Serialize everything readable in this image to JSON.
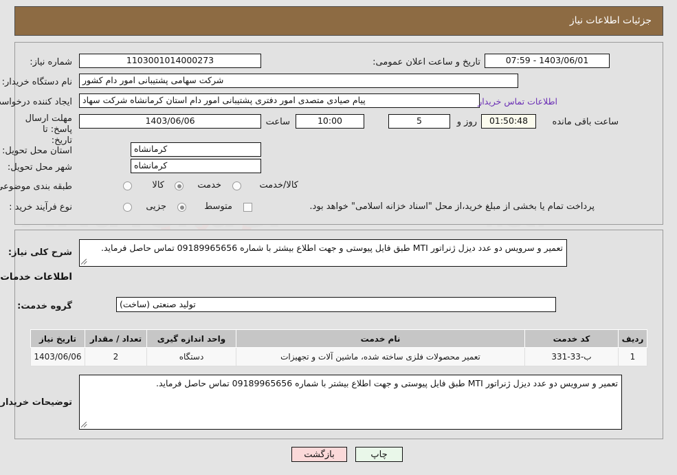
{
  "header": {
    "title": "جزئیات اطلاعات نیاز"
  },
  "form": {
    "need_number_label": "شماره نیاز:",
    "need_number_value": "1103001014000273",
    "public_announcement_label": "تاریخ و ساعت اعلان عمومی:",
    "public_announcement_value": "1403/06/01 - 07:59",
    "buyer_org_label": "نام دستگاه خریدار:",
    "buyer_org_value": "شرکت سهامی پشتیبانی امور دام کشور",
    "requester_label": "ایجاد کننده درخواست:",
    "requester_value": "پیام صیادی متصدی امور دفتری پشتیبانی امور دام استان کرمانشاه شرکت سهاد",
    "buyer_contact_link": "اطلاعات تماس خریدار",
    "deadline_label": "مهلت ارسال پاسخ: تا تاریخ:",
    "deadline_date": "1403/06/06",
    "time_label": "ساعت",
    "deadline_time": "10:00",
    "days_value": "5",
    "days_label": "روز و",
    "countdown_value": "01:50:48",
    "countdown_label": "ساعت باقی مانده",
    "province_label": "استان محل تحویل:",
    "province_value": "کرمانشاه",
    "city_label": "شهر محل تحویل:",
    "city_value": "کرمانشاه",
    "category_label": "طبقه بندی موضوعی:",
    "category_options": [
      "کالا",
      "خدمت",
      "کالا/خدمت"
    ],
    "category_selected": "خدمت",
    "purchase_type_label": "نوع فرآیند خرید :",
    "purchase_type_options": [
      "جزیی",
      "متوسط"
    ],
    "purchase_type_selected": "متوسط",
    "treasury_note": "پرداخت تمام یا بخشی از مبلغ خرید،از محل \"اسناد خزانه اسلامی\" خواهد بود.",
    "treasury_checked": false
  },
  "description": {
    "label": "شرح کلی نیاز:",
    "value": "تعمیر و سرویس دو عدد دیزل ژنراتور MTI طبق فایل پیوستی و جهت اطلاع بیشتر با شماره 09189965656 تماس حاصل فرماید."
  },
  "services_section": {
    "heading": "اطلاعات خدمات مورد نیاز",
    "group_label": "گروه خدمت:",
    "group_value": "تولید صنعتی (ساخت)"
  },
  "table": {
    "columns": [
      "ردیف",
      "کد خدمت",
      "نام خدمت",
      "واحد اندازه گیری",
      "تعداد / مقدار",
      "تاریخ نیاز"
    ],
    "rows": [
      {
        "row": "1",
        "code": "ب-33-331",
        "name": "تعمیر محصولات فلزی ساخته شده، ماشین آلات و تجهیزات",
        "unit": "دستگاه",
        "qty": "2",
        "date": "1403/06/06"
      }
    ]
  },
  "buyer_notes": {
    "label": "توضیحات خریدار:",
    "value": "تعمیر و سرویس دو عدد دیزل ژنراتور MTI طبق فایل پیوستی و جهت اطلاع بیشتر با شماره 09189965656 تماس حاصل فرماید."
  },
  "buttons": {
    "print": "چاپ",
    "back": "بازگشت"
  },
  "colors": {
    "header_bg": "#8d6b43",
    "panel_bg": "#e2e2e2",
    "page_bg": "#e4e4e4",
    "link": "#6b2fb5",
    "table_header_bg": "#c6c6c6",
    "print_btn_bg": "#e9f7e9",
    "back_btn_bg": "#fbd9d9",
    "countdown_bg": "#fbfbee"
  }
}
